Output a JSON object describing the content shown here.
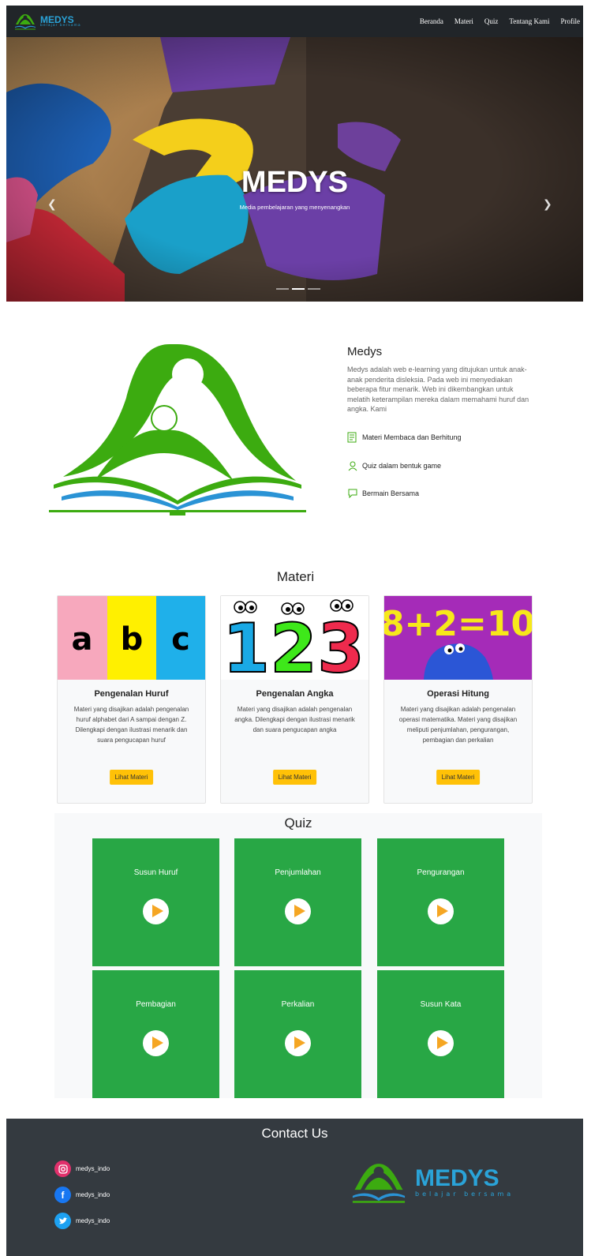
{
  "navbar": {
    "brand_name": "MEDYS",
    "brand_tagline": "belajar bersama",
    "links": [
      "Beranda",
      "Materi",
      "Quiz",
      "Tentang Kami",
      "Profile"
    ]
  },
  "hero": {
    "title": "MEDYS",
    "subtitle": "Media pembelajaran yang menyenangkan",
    "prev_icon": "chevron-left",
    "next_icon": "chevron-right",
    "slides": 3,
    "active_slide": 2
  },
  "about": {
    "title": "Medys",
    "description": "Medys adalah web e-learning yang ditujukan untuk anak-anak penderita disleksia. Pada web ini menyediakan beberapa fitur menarik. Web ini dikembangkan untuk melatih keterampilan mereka dalam memahami huruf dan angka. Kami",
    "features": [
      {
        "icon": "book-icon",
        "label": "Materi Membaca dan Berhitung"
      },
      {
        "icon": "user-icon",
        "label": "Quiz dalam bentuk game"
      },
      {
        "icon": "chat-icon",
        "label": "Bermain Bersama"
      }
    ]
  },
  "materi": {
    "title": "Materi",
    "cards": [
      {
        "image_text": "a b c",
        "title": "Pengenalan Huruf",
        "text": "Materi yang disajikan adalah pengenalan huruf alphabet dari A sampai dengan Z. Dilengkapi dengan ilustrasi menarik dan suara pengucapan huruf",
        "button": "Lihat Materi"
      },
      {
        "image_text": "123",
        "title": "Pengenalan Angka",
        "text": "Materi yang disajikan adalah pengenalan angka. Dilengkapi dengan ilustrasi menarik dan suara pengucapan angka",
        "button": "Lihat Materi"
      },
      {
        "image_text": "8+2=10",
        "title": "Operasi Hitung",
        "text": "Materi yang disajikan adalah pengenalan operasi matematika. Materi yang disajikan meliputi penjumlahan, pengurangan, pembagian dan perkalian",
        "button": "Lihat Materi"
      }
    ]
  },
  "quiz": {
    "title": "Quiz",
    "items": [
      "Susun Huruf",
      "Penjumlahan",
      "Pengurangan",
      "Pembagian",
      "Perkalian",
      "Susun Kata"
    ]
  },
  "contact": {
    "title": "Contact Us",
    "socials": [
      {
        "icon": "instagram-icon",
        "handle": "medys_indo",
        "color": "#e1306c"
      },
      {
        "icon": "facebook-icon",
        "handle": "medys_indo",
        "color": "#1877f2"
      },
      {
        "icon": "twitter-icon",
        "handle": "medys_indo",
        "color": "#1da1f2"
      }
    ],
    "logo_name": "MEDYS",
    "logo_tagline": "belajar bersama"
  },
  "colors": {
    "navbar_bg": "#212529",
    "brand_blue": "#2aa3d8",
    "logo_green": "#3cab10",
    "button_yellow": "#ffc107",
    "quiz_green": "#28a745",
    "play_orange": "#f5a623",
    "footer_bg": "#343a40"
  }
}
